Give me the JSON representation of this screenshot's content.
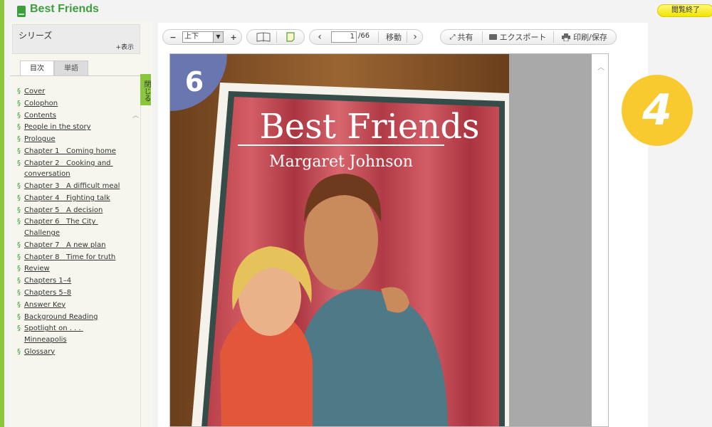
{
  "app": {
    "title": "Best Friends",
    "end_label": "閲覧終了"
  },
  "sidebar": {
    "series_title": "シリーズ",
    "series_show": "+表示",
    "tabs": [
      "目次",
      "単語"
    ],
    "close_label": "閉じる",
    "toc": [
      "Cover",
      "Colophon",
      "Contents",
      "People in the story",
      "Prologue",
      "Chapter 1   Coming home",
      "Chapter 2   Cooking and conversation",
      "Chapter 3   A difficult meal",
      "Chapter 4   Fighting talk",
      "Chapter 5   A decision",
      "Chapter 6   The City Challenge",
      "Chapter 7   A new plan",
      "Chapter 8   Time for truth",
      "Review",
      "Chapters 1–4",
      "Chapters 5–8",
      "Answer Key",
      "Background Reading",
      "Spotlight on . . . Minneapolis",
      "Glossary"
    ]
  },
  "toolbar": {
    "zoom_out": "−",
    "zoom_in": "+",
    "layout_value": "上下",
    "page_current": "1",
    "page_total": "/66",
    "go_label": "移動",
    "share_label": "共有",
    "export_label": "エクスポート",
    "print_label": "印刷/保存"
  },
  "cover": {
    "level": "6",
    "title": "Best Friends",
    "author": "Margaret Johnson"
  },
  "step_badge": "4",
  "colors": {
    "accent_green": "#8cc63f",
    "title_green": "#3e9e3e",
    "badge_yellow": "#f9c930"
  }
}
